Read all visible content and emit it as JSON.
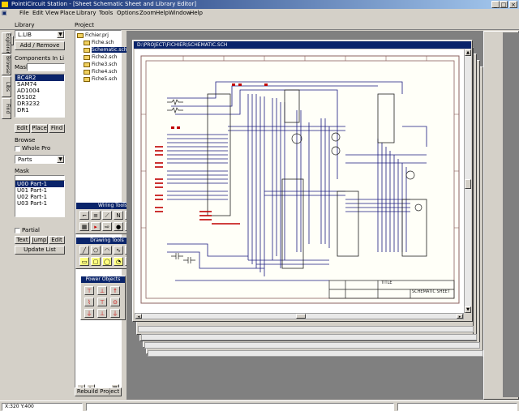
{
  "window": {
    "title": "PointiCircuit Station - [Sheet Schematic Sheet and Library Editor]"
  },
  "menu": [
    "File",
    "Edit",
    "View",
    "Place",
    "Library",
    "Tools",
    "Options",
    "Zoom",
    "Help",
    "Window",
    "Help"
  ],
  "left_panel": {
    "library_label": "Library",
    "library_value": "L.LIB",
    "add_remove": "Add / Remove",
    "components_label": "Components In Li",
    "mask_label": "Mask",
    "components": [
      "BC4R2",
      "SAM74",
      "AD1004",
      "DS102",
      "DR3232",
      "DR1"
    ],
    "edit": "Edit",
    "place": "Place",
    "find": "Find",
    "browse_label": "Browse",
    "whole_pro": "Whole Pro",
    "browse_type": "Parts",
    "mask2_label": "Mask",
    "parts": [
      "U00 Part-1",
      "U01 Part-1",
      "U02 Part-1",
      "U03 Part-1"
    ],
    "partial": "Partial",
    "text": "Text",
    "jump": "Jump",
    "edit2": "Edit",
    "update_list": "Update List"
  },
  "side_tabs": [
    "Explorer",
    "Browse",
    "Libs",
    "Find"
  ],
  "project_panel": {
    "label": "Project",
    "root": "Fichier.prj",
    "items": [
      "Fiche.sch",
      "Schematic.sch",
      "Fiche2.sch",
      "Fiche3.sch",
      "Fiche4.sch",
      "Fiche5.sch"
    ],
    "rebuild": "Rebuild Project"
  },
  "palettes": {
    "wiring": "Wiring Tools",
    "drawing": "Drawing Tools",
    "power": "Power Objects"
  },
  "document": {
    "tab_title": "D:\\PROJECT\\FICHIER\\SCHEMATIC.SCH",
    "title_block_title": "TITLE",
    "title_block_text": "SCHEMATIC SHEET"
  },
  "status": {
    "coords": "X:320 Y:400"
  },
  "colors": {
    "title_active": "#0a246a",
    "wire": "#1a1a80",
    "part": "#c00000",
    "sheet_border": "#8b0000"
  }
}
